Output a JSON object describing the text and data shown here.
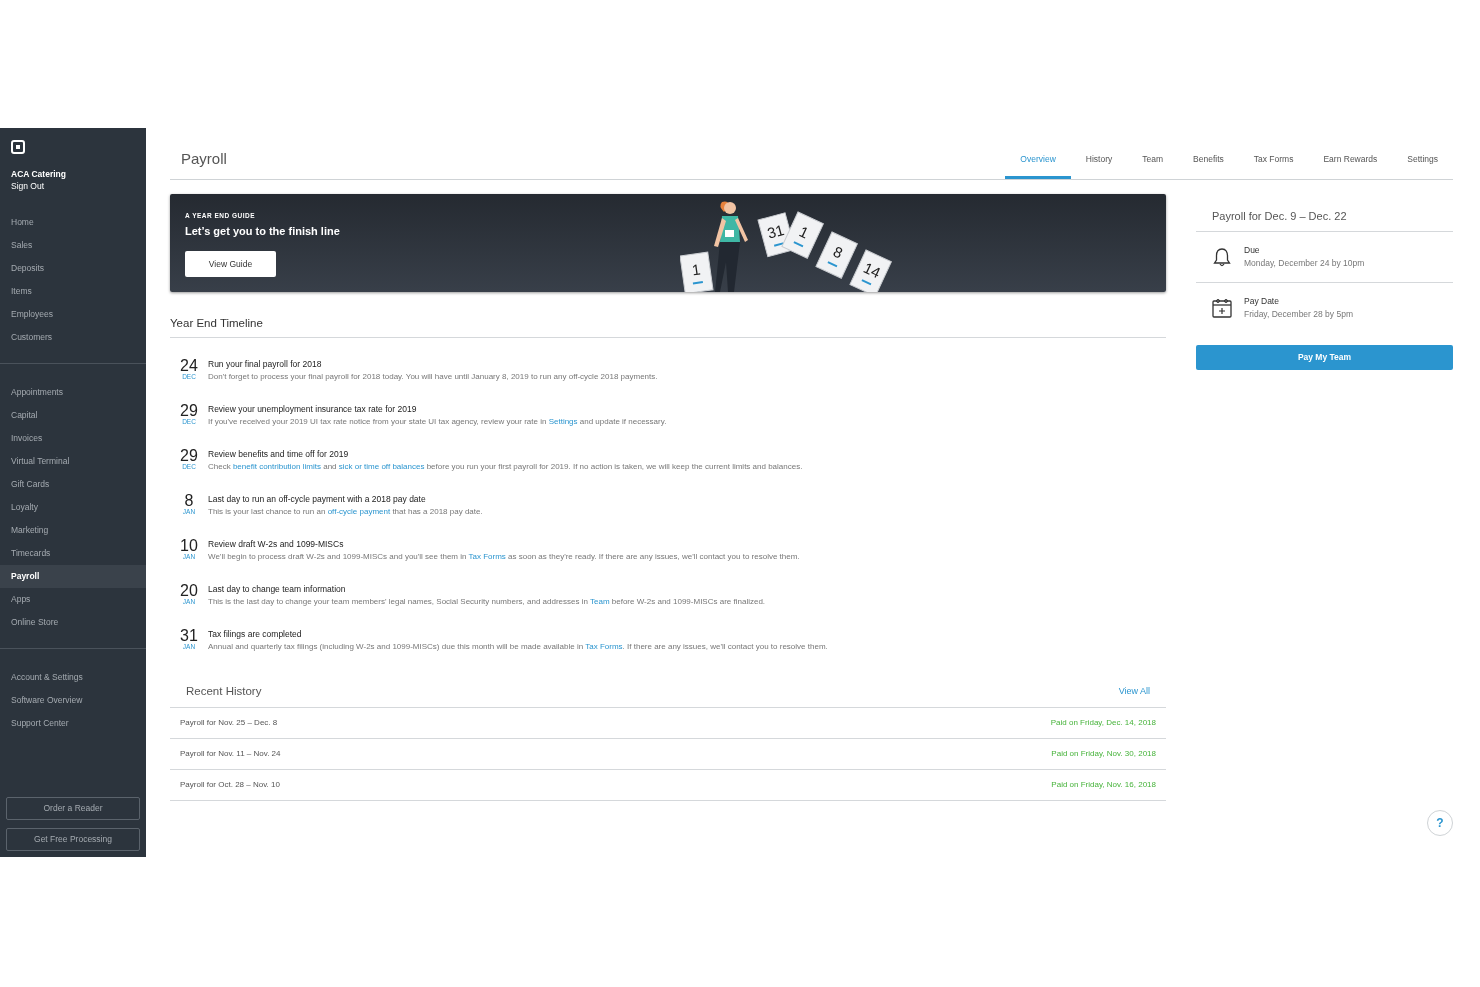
{
  "sidebar": {
    "business_name": "ACA Catering",
    "sign_out": "Sign Out",
    "sections": [
      {
        "items": [
          {
            "label": "Home",
            "selected": false
          },
          {
            "label": "Sales",
            "selected": false
          },
          {
            "label": "Deposits",
            "selected": false
          },
          {
            "label": "Items",
            "selected": false
          },
          {
            "label": "Employees",
            "selected": false
          },
          {
            "label": "Customers",
            "selected": false
          }
        ]
      },
      {
        "items": [
          {
            "label": "Appointments",
            "selected": false
          },
          {
            "label": "Capital",
            "selected": false
          },
          {
            "label": "Invoices",
            "selected": false
          },
          {
            "label": "Virtual Terminal",
            "selected": false
          },
          {
            "label": "Gift Cards",
            "selected": false
          },
          {
            "label": "Loyalty",
            "selected": false
          },
          {
            "label": "Marketing",
            "selected": false
          },
          {
            "label": "Timecards",
            "selected": false
          },
          {
            "label": "Payroll",
            "selected": true
          },
          {
            "label": "Apps",
            "selected": false
          },
          {
            "label": "Online Store",
            "selected": false
          }
        ]
      },
      {
        "items": [
          {
            "label": "Account & Settings",
            "selected": false
          },
          {
            "label": "Software Overview",
            "selected": false
          },
          {
            "label": "Support Center",
            "selected": false
          }
        ]
      }
    ],
    "buttons": [
      "Order a Reader",
      "Get Free Processing"
    ]
  },
  "header": {
    "title": "Payroll",
    "tabs": [
      {
        "label": "Overview",
        "selected": true
      },
      {
        "label": "History",
        "selected": false
      },
      {
        "label": "Team",
        "selected": false
      },
      {
        "label": "Benefits",
        "selected": false
      },
      {
        "label": "Tax Forms",
        "selected": false
      },
      {
        "label": "Earn Rewards",
        "selected": false
      },
      {
        "label": "Settings",
        "selected": false
      }
    ]
  },
  "banner": {
    "eyebrow": "A YEAR END GUIDE",
    "headline": "Let’s get you to the finish line",
    "button": "View Guide",
    "tiles": [
      {
        "day": "1"
      },
      {
        "day": "31"
      },
      {
        "day": "1"
      },
      {
        "day": "8"
      },
      {
        "day": "14"
      }
    ]
  },
  "timeline": {
    "title": "Year End Timeline",
    "events": [
      {
        "day": "24",
        "month": "DEC",
        "title": "Run your final payroll for 2018",
        "description": [
          {
            "text": "Don't forget to process your final payroll for 2018 today. You will have until January 8, 2019 to run any off-cycle 2018 payments.",
            "link": false
          }
        ]
      },
      {
        "day": "29",
        "month": "DEC",
        "title": "Review your unemployment insurance tax rate for 2019",
        "description": [
          {
            "text": "If you've received your 2019 UI tax rate notice from your state UI tax agency, review your rate in ",
            "link": false
          },
          {
            "text": "Settings",
            "link": true
          },
          {
            "text": " and update if necessary.",
            "link": false
          }
        ]
      },
      {
        "day": "29",
        "month": "DEC",
        "title": "Review benefits and time off for 2019",
        "description": [
          {
            "text": "Check ",
            "link": false
          },
          {
            "text": "benefit contribution limits",
            "link": true
          },
          {
            "text": " and ",
            "link": false
          },
          {
            "text": "sick or time off balances",
            "link": true
          },
          {
            "text": " before you run your first payroll for 2019. If no action is taken, we will keep the current limits and balances.",
            "link": false
          }
        ]
      },
      {
        "day": "8",
        "month": "JAN",
        "title": "Last day to run an off-cycle payment with a 2018 pay date",
        "description": [
          {
            "text": "This is your last chance to run an ",
            "link": false
          },
          {
            "text": "off-cycle payment",
            "link": true
          },
          {
            "text": " that has a 2018 pay date.",
            "link": false
          }
        ]
      },
      {
        "day": "10",
        "month": "JAN",
        "title": "Review draft W-2s and 1099-MISCs",
        "description": [
          {
            "text": "We'll begin to process draft W-2s and 1099-MISCs and you'll see them in ",
            "link": false
          },
          {
            "text": "Tax Forms",
            "link": true
          },
          {
            "text": " as soon as they're ready. If there are any issues, we'll contact you to resolve them.",
            "link": false
          }
        ]
      },
      {
        "day": "20",
        "month": "JAN",
        "title": "Last day to change team information",
        "description": [
          {
            "text": "This is the last day to change your team members' legal names, Social Security numbers, and addresses in ",
            "link": false
          },
          {
            "text": "Team",
            "link": true
          },
          {
            "text": " before W-2s and 1099-MISCs are finalized.",
            "link": false
          }
        ]
      },
      {
        "day": "31",
        "month": "JAN",
        "title": "Tax filings are completed",
        "description": [
          {
            "text": "Annual and quarterly tax filings (including W-2s and 1099-MISCs) due this month will be made available in ",
            "link": false
          },
          {
            "text": "Tax Forms",
            "link": true
          },
          {
            "text": ". If there are any issues, we'll contact you to resolve them.",
            "link": false
          }
        ]
      }
    ]
  },
  "recent_history": {
    "title": "Recent History",
    "view_all": "View All",
    "rows": [
      {
        "period": "Payroll for Nov. 25 – Dec. 8",
        "status": "Paid on Friday, Dec. 14, 2018"
      },
      {
        "period": "Payroll for Nov. 11 – Nov. 24",
        "status": "Paid on Friday, Nov. 30, 2018"
      },
      {
        "period": "Payroll for Oct. 28 – Nov. 10",
        "status": "Paid on Friday, Nov. 16, 2018"
      }
    ]
  },
  "pay_panel": {
    "title": "Payroll for Dec. 9 – Dec. 22",
    "items": [
      {
        "kind": "due",
        "label": "Due",
        "value": "Monday, December 24 by 10pm"
      },
      {
        "kind": "pay_date",
        "label": "Pay Date",
        "value": "Friday, December 28 by 5pm"
      }
    ],
    "button": "Pay My Team"
  },
  "help_button": "?"
}
